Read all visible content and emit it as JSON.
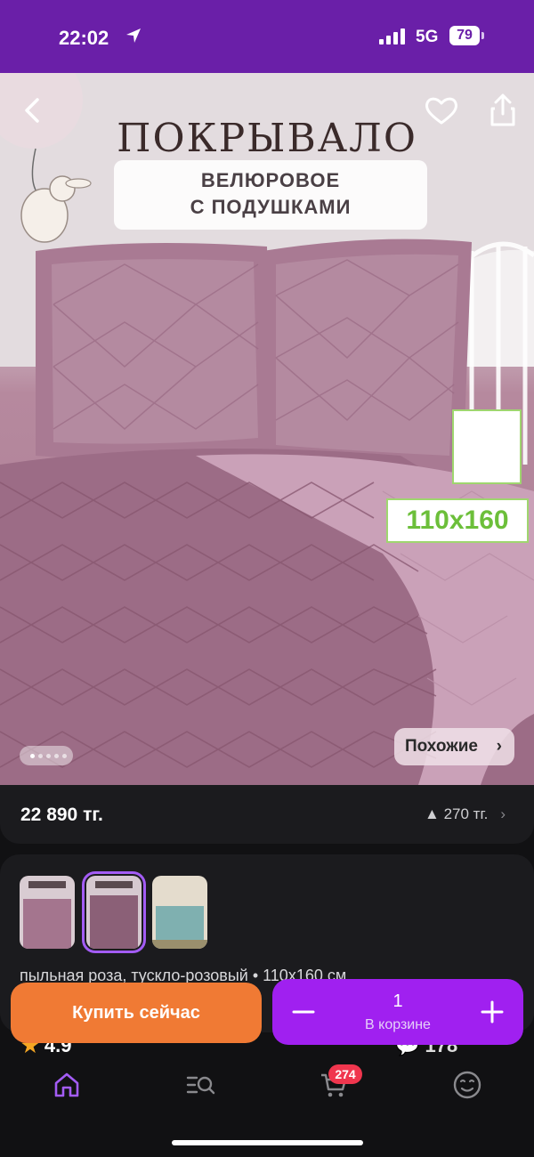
{
  "status_bar": {
    "time": "22:02",
    "network": "5G",
    "battery": "79"
  },
  "product": {
    "hero_title": "ПОКРЫВАЛО",
    "hero_subtitle_line1": "ВЕЛЮРОВОЕ",
    "hero_subtitle_line2": "С ПОДУШКАМИ",
    "size_badge": "110x160",
    "image_count": 5,
    "active_image": 1,
    "similar_label": "Похожие",
    "price": "22 890 тг.",
    "price_change": "270 тг.",
    "variant_text": "пыльная роза, тускло-розовый • 110x160 см",
    "rating": "4.9",
    "reviews": "178"
  },
  "actions": {
    "buy_now": "Купить сейчас",
    "cart_quantity": "1",
    "in_cart_label": "В корзине"
  },
  "tabbar": {
    "cart_badge": "274"
  },
  "colors": {
    "accent": "#a020f0",
    "buy": "#f07a34",
    "status_bar": "#6a1fa8",
    "badge": "#f0364e"
  }
}
